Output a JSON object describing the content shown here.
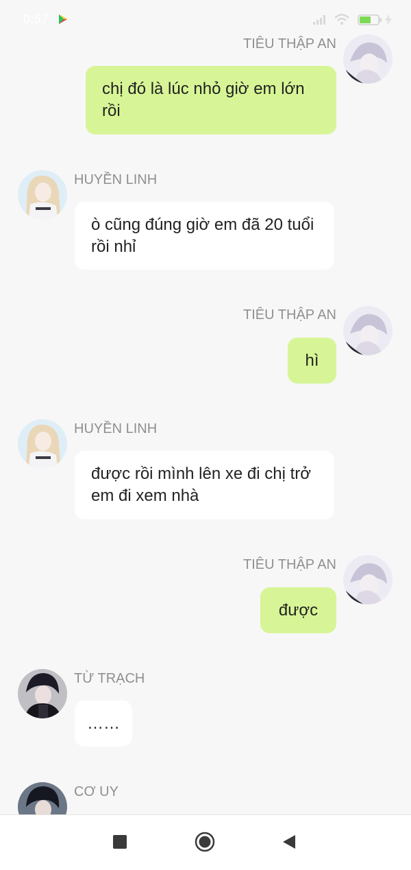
{
  "status_bar": {
    "time": "0:57",
    "icons": [
      "play-store-icon",
      "signal-icon",
      "wifi-icon",
      "battery-icon",
      "charging-icon"
    ],
    "battery_level": 0.6
  },
  "messages": [
    {
      "sender": "TIÊU THẬP AN",
      "side": "right",
      "text": "chị đó là lúc nhỏ giờ em lớn rồi"
    },
    {
      "sender": "HUYỀN LINH",
      "side": "left",
      "text": "ò cũng đúng giờ em đã 20 tuổi rồi nhỉ"
    },
    {
      "sender": "TIÊU THẬP AN",
      "side": "right",
      "text": "hì"
    },
    {
      "sender": "HUYỀN LINH",
      "side": "left",
      "text": "được rồi mình lên xe đi chị trở em đi xem nhà"
    },
    {
      "sender": "TIÊU THẬP AN",
      "side": "right",
      "text": "được"
    },
    {
      "sender": "TỪ TRẠCH",
      "side": "left",
      "text": "……"
    },
    {
      "sender": "CƠ UY",
      "side": "left",
      "text": ""
    }
  ],
  "nav_bar": {
    "icons": [
      "recents-square-icon",
      "home-circle-icon",
      "back-triangle-icon"
    ]
  },
  "colors": {
    "background": "#f7f7f7",
    "my_bubble": "#d7f596",
    "other_bubble": "#ffffff",
    "name_text": "#8f8f8f"
  }
}
